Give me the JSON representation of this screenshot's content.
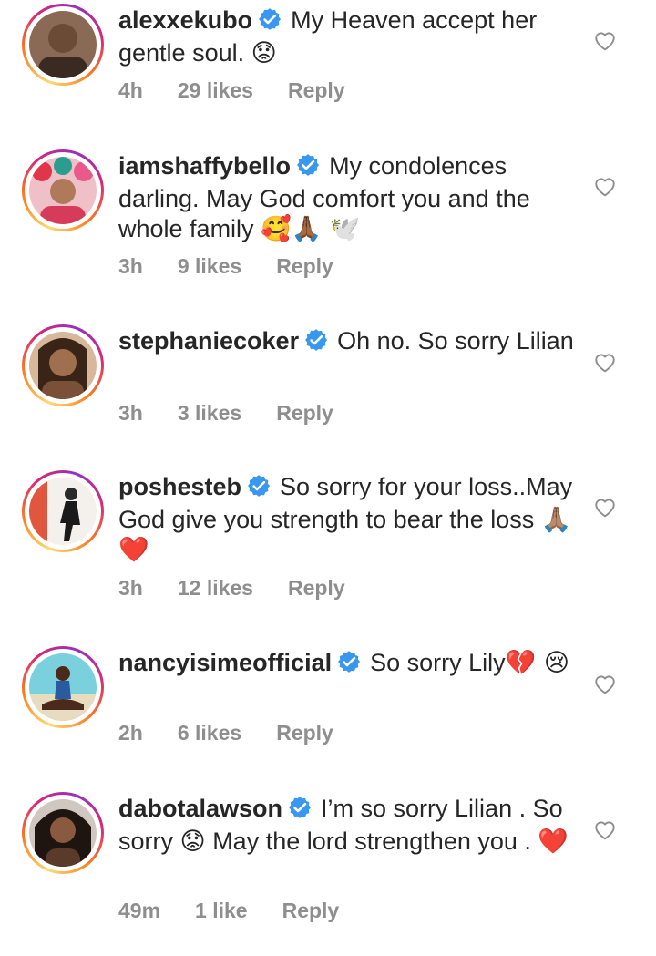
{
  "comments": [
    {
      "username": "alexxekubo",
      "text": "My Heaven accept her gentle soul.",
      "emoji": "😟",
      "time": "4h",
      "likes": "29 likes",
      "reply": "Reply",
      "avatar_color": "#a87a5a"
    },
    {
      "username": "iamshaffybello",
      "text": "My condolences darling. May God comfort you and the whole family",
      "emoji": "🥰🙏🏾 🕊️",
      "time": "3h",
      "likes": "9 likes",
      "reply": "Reply",
      "avatar_color": "#d63c5a"
    },
    {
      "username": "stephaniecoker",
      "text": "Oh no. So sorry Lilian",
      "emoji": "",
      "time": "3h",
      "likes": "3 likes",
      "reply": "Reply",
      "avatar_color": "#c89a7a"
    },
    {
      "username": "poshesteb",
      "text": "So sorry for your loss..May God give you strength to bear the loss",
      "emoji": "🙏🏽❤️",
      "time": "3h",
      "likes": "12 likes",
      "reply": "Reply",
      "avatar_color": "#e0705a"
    },
    {
      "username": "nancyisimeofficial",
      "text": "So sorry Lily",
      "emoji": "💔 😢",
      "time": "2h",
      "likes": "6 likes",
      "reply": "Reply",
      "avatar_color": "#5ab8c8"
    },
    {
      "username": "dabotalawson",
      "text": "I’m so sorry Lilian . So sorry",
      "emoji": "😟",
      "text2": "May the lord strengthen you .",
      "emoji2": "❤️",
      "time": "49m",
      "likes": "1 like",
      "reply": "Reply",
      "avatar_color": "#6b4a3a"
    }
  ],
  "colors": {
    "text": "#262626",
    "meta": "#8e8e8e",
    "verified": "#3897f0",
    "heart_outline": "#8e8e8e"
  },
  "icons": {
    "verified": "verified-badge-icon",
    "heart": "heart-outline-icon"
  }
}
